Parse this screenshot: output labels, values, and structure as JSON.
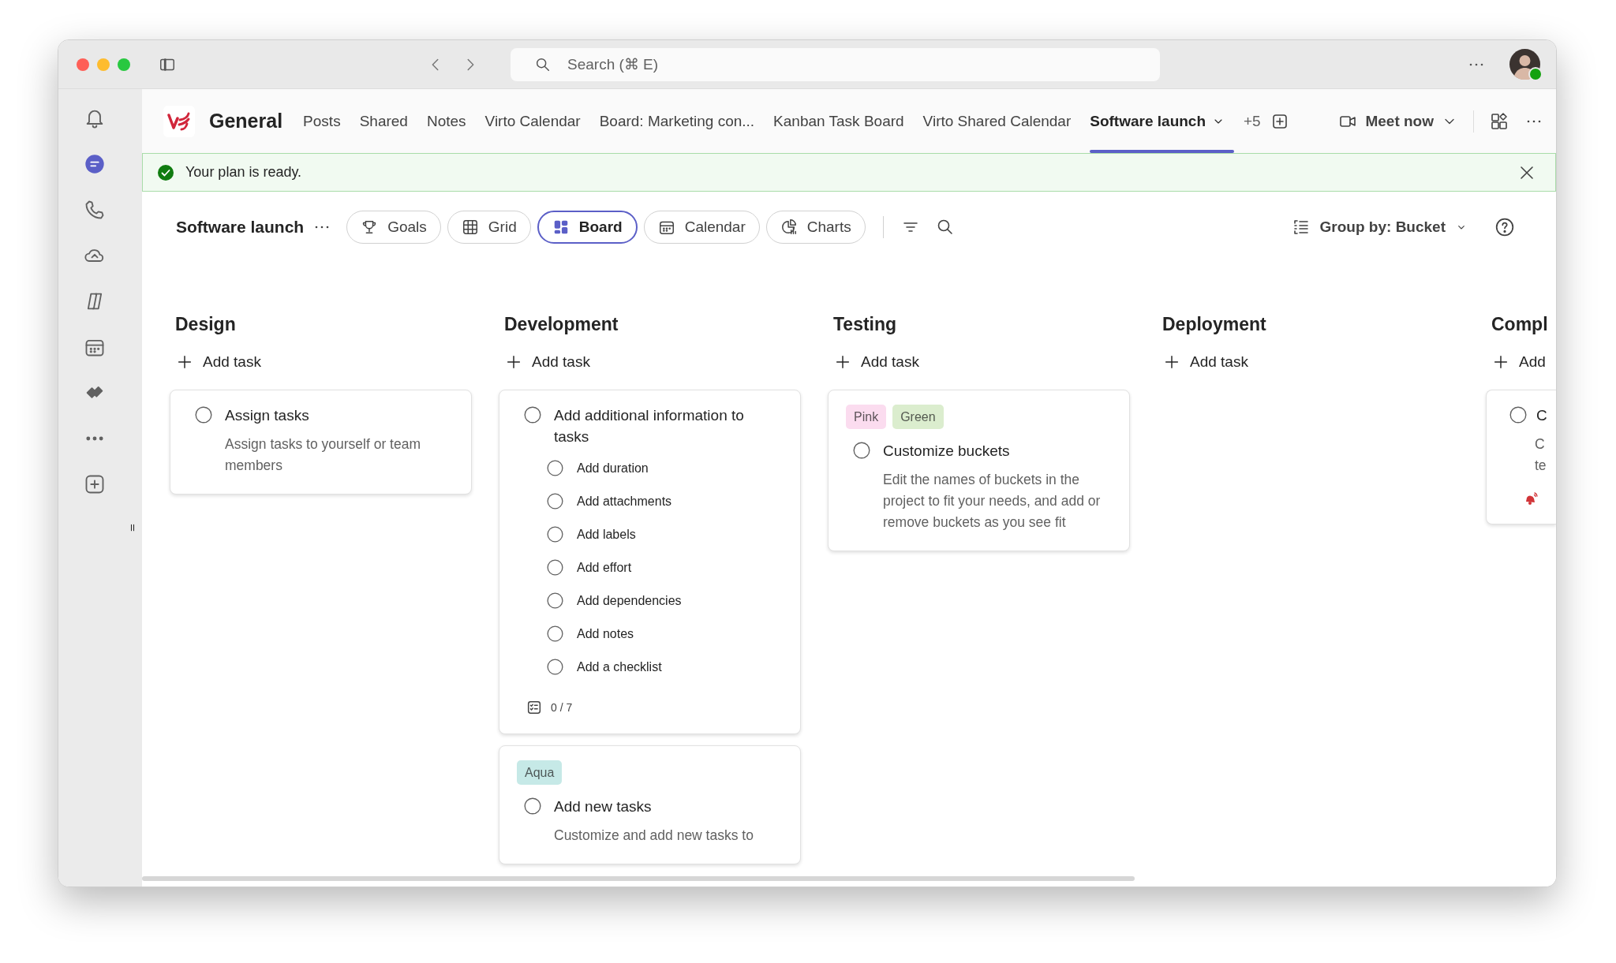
{
  "titlebar": {
    "search": {
      "placeholder": "Search (⌘ E)"
    }
  },
  "rail": [
    {
      "kind": "bell",
      "selected": false
    },
    {
      "kind": "chat",
      "selected": true
    },
    {
      "kind": "phone",
      "selected": false
    },
    {
      "kind": "cloud",
      "selected": false
    },
    {
      "kind": "copilot",
      "selected": false
    },
    {
      "kind": "calendar",
      "selected": false
    },
    {
      "kind": "planner",
      "selected": false
    },
    {
      "kind": "more",
      "selected": false
    },
    {
      "kind": "add",
      "selected": false
    }
  ],
  "channel": {
    "name": "General",
    "tabs": [
      {
        "label": "Posts",
        "selected": false
      },
      {
        "label": "Shared",
        "selected": false
      },
      {
        "label": "Notes",
        "selected": false
      },
      {
        "label": "Virto Calendar",
        "selected": false
      },
      {
        "label": "Board: Marketing con...",
        "selected": false
      },
      {
        "label": "Kanban Task Board",
        "selected": false
      },
      {
        "label": "Virto Shared Calendar",
        "selected": false
      },
      {
        "label": "Software launch",
        "selected": true
      }
    ],
    "overflow": "+5",
    "meet": "Meet now"
  },
  "banner": {
    "text": "Your plan is ready."
  },
  "plan": {
    "title": "Software launch",
    "views": [
      {
        "label": "Goals",
        "kind": "goals",
        "selected": false
      },
      {
        "label": "Grid",
        "kind": "grid",
        "selected": false
      },
      {
        "label": "Board",
        "kind": "board",
        "selected": true
      },
      {
        "label": "Calendar",
        "kind": "calendar",
        "selected": false
      },
      {
        "label": "Charts",
        "kind": "charts",
        "selected": false
      }
    ],
    "group_by": "Group by: Bucket"
  },
  "buckets": [
    {
      "name": "Design",
      "add": "Add task",
      "tasks": [
        {
          "title": "Assign tasks",
          "completed": false,
          "description_lines": [
            "Assign tasks to yourself or team members"
          ]
        }
      ]
    },
    {
      "name": "Development",
      "add": "Add task",
      "tasks": [
        {
          "title": "Add additional information to tasks",
          "completed": false,
          "checklist": [
            {
              "text": "Add duration",
              "checked": false
            },
            {
              "text": "Add attachments",
              "checked": false
            },
            {
              "text": "Add labels",
              "checked": false
            },
            {
              "text": "Add effort",
              "checked": false
            },
            {
              "text": "Add dependencies",
              "checked": false
            },
            {
              "text": "Add notes",
              "checked": false
            },
            {
              "text": "Add a checklist",
              "checked": false
            }
          ],
          "checklist_count": "0 / 7"
        },
        {
          "labels": [
            {
              "text": "Aqua",
              "color": "#c6e9e7"
            }
          ],
          "title": "Add new tasks",
          "completed": false,
          "description_lines": [
            "Customize and add new tasks to"
          ]
        }
      ]
    },
    {
      "name": "Testing",
      "add": "Add task",
      "tasks": [
        {
          "labels": [
            {
              "text": "Pink",
              "color": "#fbdcef"
            },
            {
              "text": "Green",
              "color": "#dbedce"
            }
          ],
          "title": "Customize buckets",
          "completed": false,
          "description_lines": [
            "Edit the names of buckets in the project to fit your needs, and add or remove buckets as you see fit"
          ]
        }
      ]
    },
    {
      "name": "Deployment",
      "add": "Add task"
    },
    {
      "name": "Compl",
      "add": "Add",
      "tasks": [
        {
          "title": "C",
          "completed": false,
          "description_lines": [
            "C",
            "te"
          ],
          "urgent": true
        }
      ]
    }
  ]
}
